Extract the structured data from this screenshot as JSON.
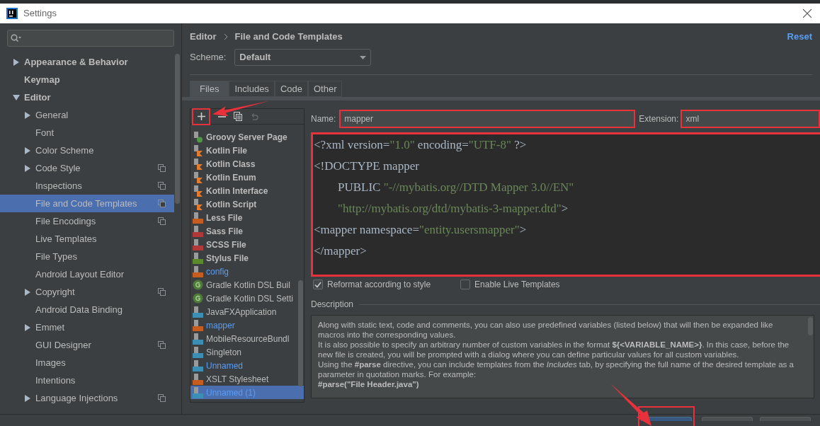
{
  "window": {
    "title": "Settings"
  },
  "sidebar": {
    "items": [
      {
        "label": "Appearance & Behavior",
        "expanded": false,
        "selected": false,
        "scoped": false
      },
      {
        "label": "Keymap",
        "selected": false,
        "scoped": false
      },
      {
        "label": "Editor",
        "expanded": true,
        "selected": false,
        "scoped": false,
        "children": [
          {
            "label": "General",
            "expanded": false,
            "selected": false,
            "scoped": false
          },
          {
            "label": "Font",
            "selected": false,
            "scoped": false
          },
          {
            "label": "Color Scheme",
            "expanded": false,
            "selected": false,
            "scoped": false
          },
          {
            "label": "Code Style",
            "expanded": false,
            "selected": false,
            "scoped": true
          },
          {
            "label": "Inspections",
            "selected": false,
            "scoped": true
          },
          {
            "label": "File and Code Templates",
            "selected": true,
            "scoped": true
          },
          {
            "label": "File Encodings",
            "selected": false,
            "scoped": true
          },
          {
            "label": "Live Templates",
            "selected": false,
            "scoped": false
          },
          {
            "label": "File Types",
            "selected": false,
            "scoped": false
          },
          {
            "label": "Android Layout Editor",
            "selected": false,
            "scoped": false
          },
          {
            "label": "Copyright",
            "expanded": false,
            "selected": false,
            "scoped": true
          },
          {
            "label": "Android Data Binding",
            "selected": false,
            "scoped": false
          },
          {
            "label": "Emmet",
            "expanded": false,
            "selected": false,
            "scoped": false
          },
          {
            "label": "GUI Designer",
            "selected": false,
            "scoped": true
          },
          {
            "label": "Images",
            "selected": false,
            "scoped": false
          },
          {
            "label": "Intentions",
            "selected": false,
            "scoped": false
          },
          {
            "label": "Language Injections",
            "expanded": false,
            "selected": false,
            "scoped": true
          }
        ]
      }
    ]
  },
  "breadcrumb": [
    "Editor",
    "File and Code Templates"
  ],
  "reset": "Reset",
  "scheme": {
    "label": "Scheme:",
    "value": "Default"
  },
  "tabs": [
    {
      "label": "Files",
      "selected": true
    },
    {
      "label": "Includes",
      "selected": false
    },
    {
      "label": "Code",
      "selected": false
    },
    {
      "label": "Other",
      "selected": false
    }
  ],
  "templates": [
    {
      "name": "Groovy Server Page",
      "kind": "groovy",
      "modified": false,
      "selected": false
    },
    {
      "name": "Kotlin File",
      "kind": "kotlin",
      "modified": false,
      "selected": false
    },
    {
      "name": "Kotlin Class",
      "kind": "kotlin",
      "modified": false,
      "selected": false
    },
    {
      "name": "Kotlin Enum",
      "kind": "kotlin",
      "modified": false,
      "selected": false
    },
    {
      "name": "Kotlin Interface",
      "kind": "kotlin",
      "modified": false,
      "selected": false
    },
    {
      "name": "Kotlin Script",
      "kind": "kotlin",
      "modified": false,
      "selected": false
    },
    {
      "name": "Less File",
      "kind": "less",
      "modified": false,
      "selected": false
    },
    {
      "name": "Sass File",
      "kind": "sass",
      "modified": false,
      "selected": false
    },
    {
      "name": "SCSS File",
      "kind": "sass",
      "modified": false,
      "selected": false
    },
    {
      "name": "Stylus File",
      "kind": "stylus",
      "modified": false,
      "selected": false
    },
    {
      "name": "config",
      "kind": "xml",
      "modified": true,
      "selected": false
    },
    {
      "name": "Gradle Kotlin DSL Buil",
      "kind": "gradle",
      "modified": false,
      "selected": false
    },
    {
      "name": "Gradle Kotlin DSL Setti",
      "kind": "gradle",
      "modified": false,
      "selected": false
    },
    {
      "name": "JavaFXApplication",
      "kind": "java",
      "modified": false,
      "selected": false
    },
    {
      "name": "mapper",
      "kind": "xml",
      "modified": true,
      "selected": false
    },
    {
      "name": "MobileResourceBundl",
      "kind": "java",
      "modified": false,
      "selected": false
    },
    {
      "name": "Singleton",
      "kind": "java",
      "modified": false,
      "selected": false
    },
    {
      "name": "Unnamed",
      "kind": "java",
      "modified": true,
      "selected": false
    },
    {
      "name": "XSLT Stylesheet",
      "kind": "xml",
      "modified": false,
      "selected": false
    },
    {
      "name": "Unnamed (1)",
      "kind": "java",
      "modified": true,
      "selected": true
    }
  ],
  "name_field": {
    "label": "Name:",
    "value": "mapper"
  },
  "extension_field": {
    "label": "Extension:",
    "value": "xml"
  },
  "code": [
    [
      {
        "text": "<?xml version=",
        "kind": "tag"
      },
      {
        "text": "\"1.0\"",
        "kind": "string"
      },
      {
        "text": " encoding=",
        "kind": "tag"
      },
      {
        "text": "\"UTF-8\"",
        "kind": "string"
      },
      {
        "text": " ?>",
        "kind": "tag"
      }
    ],
    [
      {
        "text": "<!DOCTYPE mapper",
        "kind": "tag"
      }
    ],
    [
      {
        "text": "        PUBLIC ",
        "kind": "tag"
      },
      {
        "text": "\"-//mybatis.org//DTD Mapper 3.0//EN\"",
        "kind": "string"
      }
    ],
    [
      {
        "text": "        \"http://mybatis.org/dtd/mybatis-3-mapper.dtd\"",
        "kind": "string"
      },
      {
        "text": ">",
        "kind": "tag"
      }
    ],
    [
      {
        "text": "<mapper namespace=",
        "kind": "tag"
      },
      {
        "text": "\"entity.usersmapper\"",
        "kind": "string"
      },
      {
        "text": ">",
        "kind": "tag"
      }
    ],
    [
      {
        "text": "</mapper>",
        "kind": "tag"
      }
    ]
  ],
  "options": [
    {
      "label": "Reformat according to style",
      "checked": true
    },
    {
      "label": "Enable Live Templates",
      "checked": false
    }
  ],
  "description": {
    "title": "Description",
    "paragraphs": [
      "Along with static text, code and comments, you can also use predefined variables (listed below) that will then be expanded like macros into the corresponding values.",
      "It is also possible to specify an arbitrary number of custom variables in the format **${<VARIABLE_NAME>}**. In this case, before the new file is created, you will be prompted with a dialog where you can define particular values for all custom variables.",
      "Using the **#parse** directive, you can include templates from the *Includes* tab, by specifying the full name of the desired template as a parameter in quotation marks. For example:",
      "**#parse(\"File Header.java\")**"
    ]
  },
  "footer_buttons": [
    {
      "kind": "primary"
    },
    {
      "kind": "normal"
    },
    {
      "kind": "normal"
    }
  ]
}
